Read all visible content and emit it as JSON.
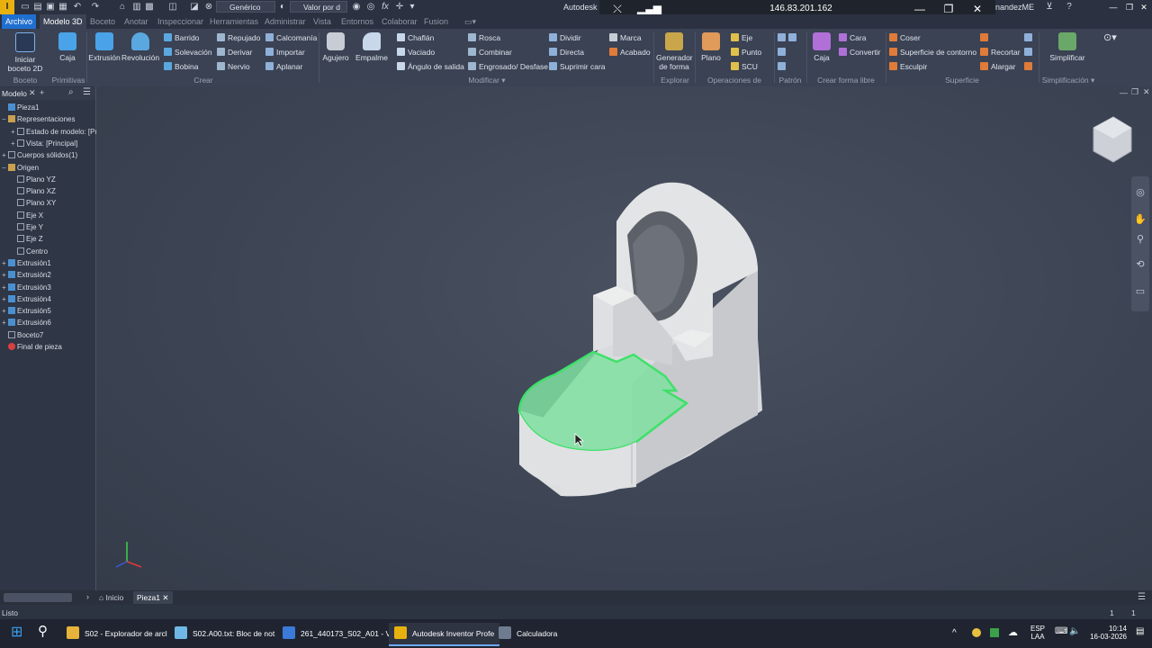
{
  "window": {
    "title_fragment": "Autodesk I",
    "remote_ip": "146.83.201.162",
    "user": "nandezME",
    "material_combo": "Genérico",
    "appearance_combo": "Valor por d"
  },
  "tabs": [
    "Archivo",
    "Modelo 3D",
    "Boceto",
    "Anotar",
    "Inspeccionar",
    "Herramientas",
    "Administrar",
    "Vista",
    "Entornos",
    "Colaborar",
    "Fusion"
  ],
  "active_tab": "Modelo 3D",
  "ribbon": {
    "boceto": {
      "title": "Boceto",
      "start_sketch": "Iniciar boceto 2D"
    },
    "primitivas": {
      "title": "Primitivas",
      "box": "Caja"
    },
    "crear": {
      "title": "Crear",
      "extrude": "Extrusión",
      "revolve": "Revolución",
      "col1": [
        "Barrido",
        "Solevación",
        "Bobina"
      ],
      "col2": [
        "Repujado",
        "Derivar",
        "Nervio"
      ],
      "col3": [
        "Calcomanía",
        "Importar",
        "Aplanar"
      ]
    },
    "modificar": {
      "title": "Modificar",
      "hole": "Agujero",
      "fillet": "Empalme",
      "col1": [
        "Chaflán",
        "Vaciado",
        "Ángulo de salida"
      ],
      "col2": [
        "Rosca",
        "Combinar",
        "Engrosado/ Desfase"
      ],
      "col3": [
        "Dividir",
        "Directa",
        "Suprimir cara"
      ],
      "col4": [
        "Marca",
        "Acabado"
      ]
    },
    "explorar": {
      "title": "Explorar",
      "generator": "Generador de forma"
    },
    "operaciones": {
      "title": "Operaciones de trabajo",
      "plane": "Plano",
      "items": [
        "Eje",
        "Punto",
        "SCU"
      ]
    },
    "patron": {
      "title": "Patrón"
    },
    "forma_libre": {
      "title": "Crear forma libre",
      "box": "Caja",
      "items": [
        "Cara",
        "Convertir"
      ]
    },
    "superficie": {
      "title": "Superficie",
      "col1": [
        "Coser",
        "Superficie de contorno",
        "Esculpir"
      ],
      "col2": [
        "Recortar",
        "Alargar"
      ]
    },
    "simplificacion": {
      "title": "Simplificación",
      "simplify": "Simplificar"
    }
  },
  "browser": {
    "tab": "Modelo",
    "items": [
      {
        "label": "Pieza1",
        "indent": 0,
        "exp": ""
      },
      {
        "label": "Representaciones",
        "indent": 0,
        "exp": "−"
      },
      {
        "label": "Estado de modelo: [Pr",
        "indent": 1,
        "exp": "+"
      },
      {
        "label": "Vista: [Principal]",
        "indent": 1,
        "exp": "+"
      },
      {
        "label": "Cuerpos sólidos(1)",
        "indent": 0,
        "exp": "+"
      },
      {
        "label": "Origen",
        "indent": 0,
        "exp": "−"
      },
      {
        "label": "Plano YZ",
        "indent": 1,
        "exp": ""
      },
      {
        "label": "Plano XZ",
        "indent": 1,
        "exp": ""
      },
      {
        "label": "Plano XY",
        "indent": 1,
        "exp": ""
      },
      {
        "label": "Eje X",
        "indent": 1,
        "exp": ""
      },
      {
        "label": "Eje Y",
        "indent": 1,
        "exp": ""
      },
      {
        "label": "Eje Z",
        "indent": 1,
        "exp": ""
      },
      {
        "label": "Centro",
        "indent": 1,
        "exp": ""
      },
      {
        "label": "Extrusión1",
        "indent": 0,
        "exp": "+"
      },
      {
        "label": "Extrusión2",
        "indent": 0,
        "exp": "+"
      },
      {
        "label": "Extrusión3",
        "indent": 0,
        "exp": "+"
      },
      {
        "label": "Extrusión4",
        "indent": 0,
        "exp": "+"
      },
      {
        "label": "Extrusión5",
        "indent": 0,
        "exp": "+"
      },
      {
        "label": "Extrusión6",
        "indent": 0,
        "exp": "+"
      },
      {
        "label": "Boceto7",
        "indent": 0,
        "exp": ""
      },
      {
        "label": "Final de pieza",
        "indent": 0,
        "exp": ""
      }
    ]
  },
  "doc_tabs": {
    "home": "Inicio",
    "part": "Pieza1"
  },
  "status": {
    "text": "Listo",
    "count1": "1",
    "count2": "1"
  },
  "taskbar": {
    "apps": [
      "S02 - Explorador de arcl",
      "S02.A00.txt: Bloc de not",
      "261_440173_S02_A01 - V",
      "Autodesk Inventor Profe",
      "Calculadora"
    ],
    "lang1": "ESP",
    "lang2": "LAA",
    "time": "10:14",
    "date": "16-03-2026"
  },
  "colors": {
    "selection": "#3fe06a",
    "accent": "#1f6fd0",
    "logo": "#e8b10e"
  }
}
